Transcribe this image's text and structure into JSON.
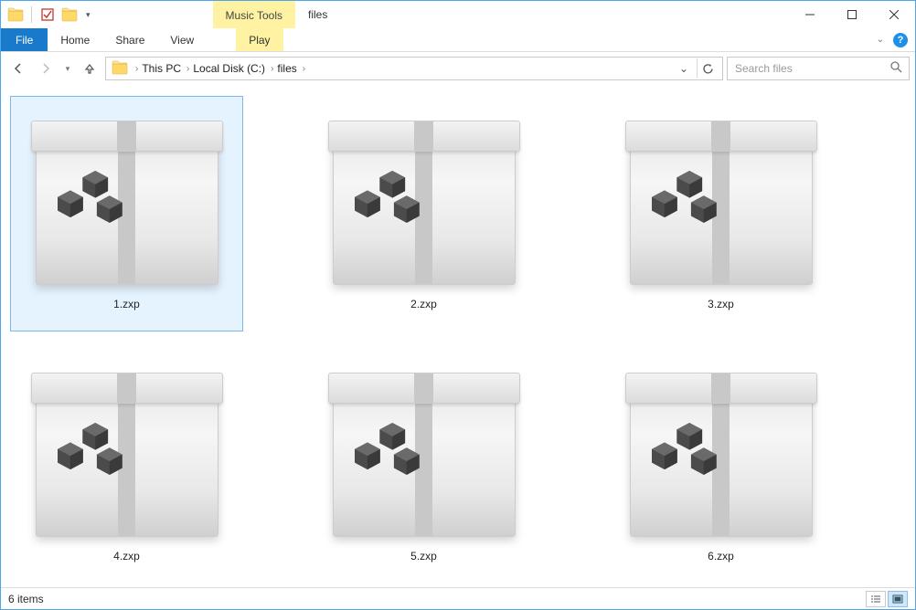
{
  "window": {
    "title": "files",
    "context_tab": "Music Tools"
  },
  "ribbon": {
    "file": "File",
    "home": "Home",
    "share": "Share",
    "view": "View",
    "play": "Play"
  },
  "breadcrumb": {
    "items": [
      "This PC",
      "Local Disk (C:)",
      "files"
    ]
  },
  "search": {
    "placeholder": "Search files"
  },
  "files": {
    "items": [
      {
        "name": "1.zxp",
        "selected": true
      },
      {
        "name": "2.zxp",
        "selected": false
      },
      {
        "name": "3.zxp",
        "selected": false
      },
      {
        "name": "4.zxp",
        "selected": false
      },
      {
        "name": "5.zxp",
        "selected": false
      },
      {
        "name": "6.zxp",
        "selected": false
      }
    ]
  },
  "statusbar": {
    "count_label": "6 items"
  }
}
